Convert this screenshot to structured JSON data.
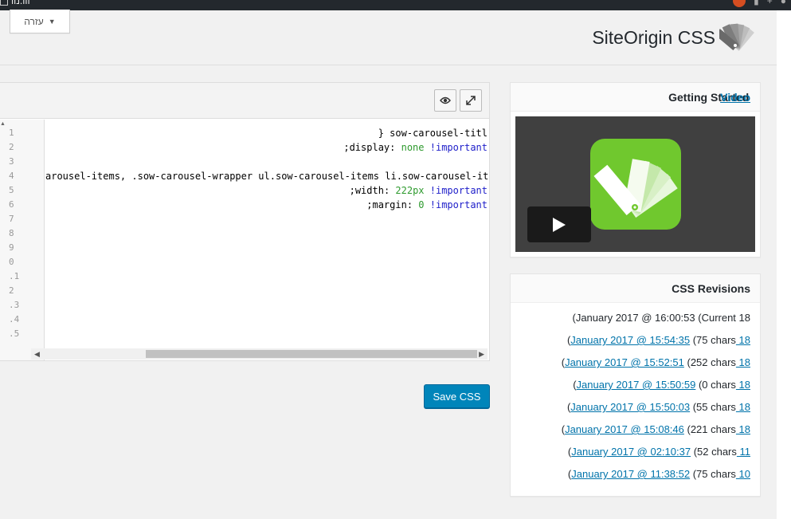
{
  "admin_bar": {
    "site_label": "ווו.נוו"
  },
  "help": {
    "label": "עזרה"
  },
  "page": {
    "title": "SiteOrigin CSS"
  },
  "editor": {
    "line_numbers": [
      "1",
      "2",
      "3",
      "4",
      "5",
      "6",
      "7",
      "8",
      "9",
      "0",
      ".1",
      "2",
      ".3",
      ".4",
      ".5"
    ],
    "lines": [
      {
        "text": "} sow-carousel-titl",
        "value": "",
        "important": ""
      },
      {
        "text": ";display: ",
        "value": "none",
        "important": "!important"
      },
      {
        "text": "",
        "value": "",
        "important": ""
      },
      {
        "text": "arousel-items, .sow-carousel-wrapper ul.sow-carousel-items li.sow-carousel-iter",
        "value": "",
        "important": ""
      },
      {
        "text": ";width: ",
        "value": "222px",
        "important": "!important"
      },
      {
        "text": ";margin: ",
        "value": "0",
        "important": "!important"
      }
    ]
  },
  "save_button": {
    "label": "Save CSS"
  },
  "video_box": {
    "title": "Getting Started ",
    "link": "Video"
  },
  "revisions": {
    "title": "CSS Revisions",
    "current": "(January 2017 @ 16:00:53 (Current 18",
    "items": [
      {
        "prefix": "(",
        "date": "January 2017 @ 15:54:35",
        "chars": " (75 chars",
        "day": " 18"
      },
      {
        "prefix": "(",
        "date": "January 2017 @ 15:52:51",
        "chars": " (252 chars",
        "day": " 18"
      },
      {
        "prefix": "(",
        "date": "January 2017 @ 15:50:59",
        "chars": " (0 chars",
        "day": " 18"
      },
      {
        "prefix": "(",
        "date": "January 2017 @ 15:50:03",
        "chars": " (55 chars",
        "day": " 18"
      },
      {
        "prefix": "(",
        "date": "January 2017 @ 15:08:46",
        "chars": " (221 chars",
        "day": " 18"
      },
      {
        "prefix": "(",
        "date": "January 2017 @ 02:10:37",
        "chars": " (52 chars",
        "day": " 11"
      },
      {
        "prefix": "(",
        "date": "January 2017 @ 11:38:52",
        "chars": " (75 chars",
        "day": " 10"
      }
    ]
  },
  "colors": {
    "primary": "#0085ba",
    "link": "#0073aa",
    "brand_green": "#70c82e"
  }
}
